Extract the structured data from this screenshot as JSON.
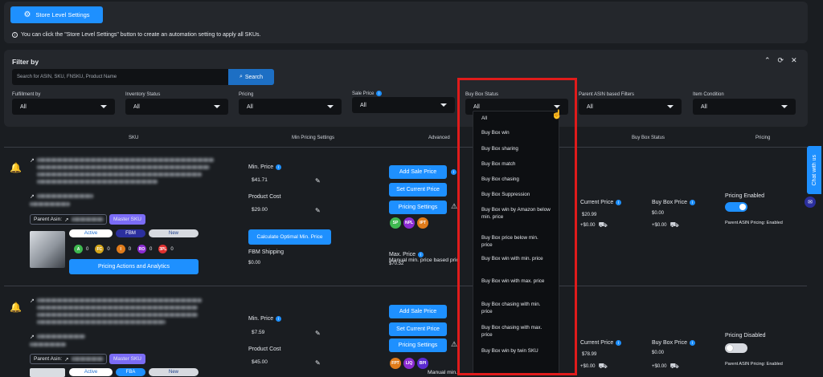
{
  "top_panel": {
    "store_button": "Store Level Settings",
    "info_text": "You can click the \"Store Level Settings\" button to create an automation setting to apply all SKUs."
  },
  "filter": {
    "title": "Filter by",
    "search_placeholder": "Search for ASIN, SKU, FNSKU, Product Name",
    "search_button": "Search",
    "fields": [
      {
        "label": "Fulfillment by",
        "value": "All"
      },
      {
        "label": "Inventory Status",
        "value": "All"
      },
      {
        "label": "Pricing",
        "value": "All"
      },
      {
        "label": "Sale Price",
        "value": "All"
      },
      {
        "label": "Buy Box Status",
        "value": "All"
      },
      {
        "label": "Parent ASIN based Filters",
        "value": "All"
      },
      {
        "label": "Item Condition",
        "value": "All"
      }
    ]
  },
  "dropdown": {
    "options": [
      "All",
      "Buy Box win",
      "Buy Box sharing",
      "Buy Box match",
      "Buy Box chasing",
      "Buy Box Suppression",
      "Buy Box win by Amazon below min. price",
      "Buy Box price below min. price",
      "Buy Box win with min. price",
      "Buy Box win with max. price",
      "Buy Box chasing with min. price",
      "Buy Box chasing with max. price",
      "Buy Box win by twin SKU"
    ]
  },
  "table_headers": {
    "sku": "SKU",
    "min_pricing": "Min Pricing Settings",
    "advanced": "Advanced",
    "buy_box": "Buy Box Status",
    "pricing": "Pricing"
  },
  "rows": [
    {
      "parent_asin_label": "Parent Asin:",
      "master_sku": "Master SKU",
      "status": "Active",
      "fulfillment": "FBM",
      "condition": "New",
      "badges": [
        {
          "code": "A",
          "count": "0"
        },
        {
          "code": "FC",
          "count": "0"
        },
        {
          "code": "I",
          "count": "0"
        },
        {
          "code": "RO",
          "count": "0"
        },
        {
          "code": "3PL",
          "count": "0"
        }
      ],
      "actions_button": "Pricing Actions and Analytics",
      "min_price_label": "Min. Price",
      "min_price": "$41.71",
      "product_cost_label": "Product Cost",
      "product_cost": "$29.00",
      "calc_button": "Calculate Optimal Min. Price",
      "fbm_shipping_label": "FBM Shipping",
      "fbm_shipping": "$0.00",
      "add_sale": "Add Sale Price",
      "set_current": "Set Current Price",
      "pricing_settings": "Pricing Settings",
      "adv_badges": [
        "SP",
        "NPL",
        "IPT"
      ],
      "manual_text": "Manual min. price based pricing",
      "max_price_label": "Max. Price",
      "max_price": "$70.52",
      "current_price_label": "Current Price",
      "current_price": "$20.99",
      "current_ship": "+$0.00",
      "buybox_price_label": "Buy Box Price",
      "buybox_price": "$0.00",
      "buybox_ship": "+$0.00",
      "pricing_state": "Pricing Enabled",
      "parent_pricing": "Parent ASIN Pricing: Enabled"
    },
    {
      "parent_asin_label": "Parent Asin:",
      "master_sku": "Master SKU",
      "status": "Active",
      "fulfillment": "FBA",
      "condition": "New",
      "min_price_label": "Min. Price",
      "min_price": "$7.59",
      "product_cost_label": "Product Cost",
      "product_cost": "$45.00",
      "add_sale": "Add Sale Price",
      "set_current": "Set Current Price",
      "pricing_settings": "Pricing Settings",
      "adv_badges": [
        "FPT",
        "LIQ",
        "BPI"
      ],
      "manual_text": "Manual min. price based pricing",
      "current_price_label": "Current Price",
      "current_price": "$78.99",
      "current_ship": "+$0.00",
      "buybox_price_label": "Buy Box Price",
      "buybox_price": "$0.00",
      "buybox_ship": "+$0.00",
      "pricing_state": "Pricing Disabled",
      "parent_pricing": "Parent ASIN Pricing: Enabled"
    }
  ],
  "chat": {
    "label": "Chat with us"
  },
  "colors": {
    "accent": "#1e90ff",
    "highlight": "#e01b1b",
    "master": "#7b6cf6"
  }
}
